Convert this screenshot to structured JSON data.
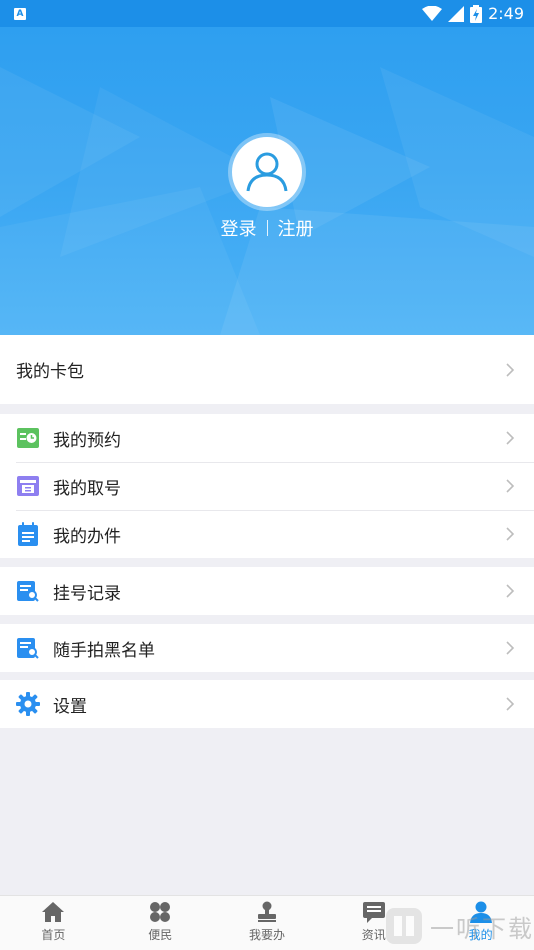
{
  "status_bar": {
    "time": "2:49",
    "app_badge": "A"
  },
  "header": {
    "login": "登录",
    "register": "注册"
  },
  "card_section": {
    "items": [
      {
        "label": "我的卡包"
      }
    ]
  },
  "menu_group_1": {
    "items": [
      {
        "label": "我的预约",
        "icon": "appointment-icon",
        "color": "#5cc25f"
      },
      {
        "label": "我的取号",
        "icon": "ticket-icon",
        "color": "#8e7ff0"
      },
      {
        "label": "我的办件",
        "icon": "document-list-icon",
        "color": "#2a8ff0"
      }
    ]
  },
  "menu_group_2": {
    "items": [
      {
        "label": "挂号记录",
        "icon": "record-search-icon",
        "color": "#2a8ff0"
      }
    ]
  },
  "menu_group_3": {
    "items": [
      {
        "label": "随手拍黑名单",
        "icon": "blacklist-search-icon",
        "color": "#2a8ff0"
      }
    ]
  },
  "menu_group_4": {
    "items": [
      {
        "label": "设置",
        "icon": "gear-icon",
        "color": "#2a8ff0"
      }
    ]
  },
  "tabbar": {
    "tabs": [
      {
        "label": "首页",
        "icon": "home-icon"
      },
      {
        "label": "便民",
        "icon": "clover-icon"
      },
      {
        "label": "我要办",
        "icon": "stamp-icon"
      },
      {
        "label": "资讯",
        "icon": "news-icon"
      },
      {
        "label": "我的",
        "icon": "user-icon",
        "active": true
      }
    ]
  },
  "watermark": {
    "text": "一听下载"
  },
  "colors": {
    "accent": "#1c8fe8",
    "header_top": "#2e9ff0",
    "background": "#efeff4"
  }
}
